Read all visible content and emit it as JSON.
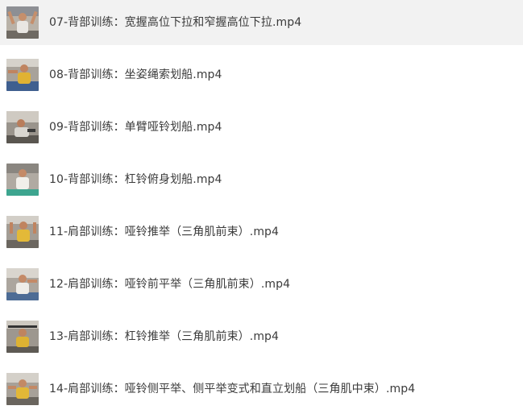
{
  "files": [
    {
      "name": "07-背部训练：宽握高位下拉和窄握高位下拉.mp4",
      "selected": true,
      "thumbnail": "gym-video-thumbnail"
    },
    {
      "name": "08-背部训练：坐姿绳索划船.mp4",
      "selected": false,
      "thumbnail": "gym-video-thumbnail"
    },
    {
      "name": "09-背部训练：单臂哑铃划船.mp4",
      "selected": false,
      "thumbnail": "gym-video-thumbnail"
    },
    {
      "name": "10-背部训练：杠铃俯身划船.mp4",
      "selected": false,
      "thumbnail": "gym-video-thumbnail"
    },
    {
      "name": "11-肩部训练：哑铃推举（三角肌前束）.mp4",
      "selected": false,
      "thumbnail": "gym-video-thumbnail"
    },
    {
      "name": "12-肩部训练：哑铃前平举（三角肌前束）.mp4",
      "selected": false,
      "thumbnail": "gym-video-thumbnail"
    },
    {
      "name": "13-肩部训练：杠铃推举（三角肌前束）.mp4",
      "selected": false,
      "thumbnail": "gym-video-thumbnail"
    },
    {
      "name": "14-肩部训练：哑铃侧平举、侧平举变式和直立划船（三角肌中束）.mp4",
      "selected": false,
      "thumbnail": "gym-video-thumbnail"
    }
  ],
  "colors": {
    "selected_row_bg": "#f2f2f2",
    "text": "#3b3b3b"
  }
}
